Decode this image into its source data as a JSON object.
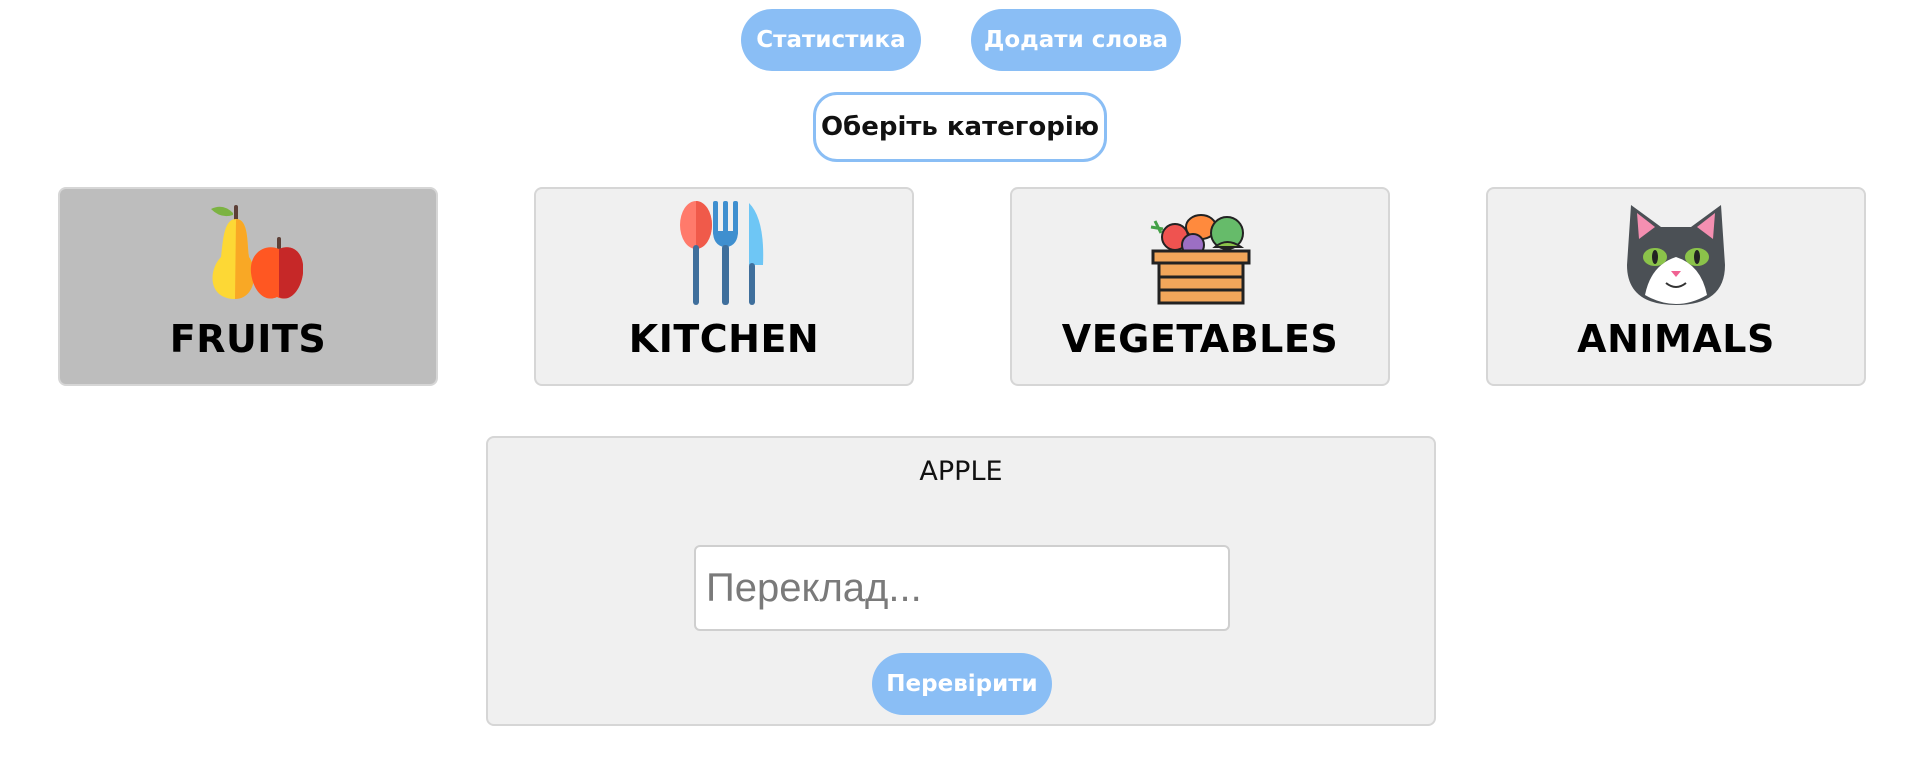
{
  "header": {
    "stats_label": "Статистика",
    "add_words_label": "Додати слова"
  },
  "category_heading": "Оберіть категорію",
  "categories": [
    {
      "label": "FRUITS",
      "icon": "fruits-icon",
      "selected": true
    },
    {
      "label": "KITCHEN",
      "icon": "cutlery-icon",
      "selected": false
    },
    {
      "label": "VEGETABLES",
      "icon": "vegetable-crate-icon",
      "selected": false
    },
    {
      "label": "ANIMALS",
      "icon": "cat-icon",
      "selected": false
    }
  ],
  "quiz": {
    "word": "APPLE",
    "input_placeholder": "Переклад...",
    "check_label": "Перевірити"
  },
  "colors": {
    "accent": "#8abef5",
    "card_bg": "#f0f0f0",
    "card_selected_bg": "#bdbdbd"
  }
}
